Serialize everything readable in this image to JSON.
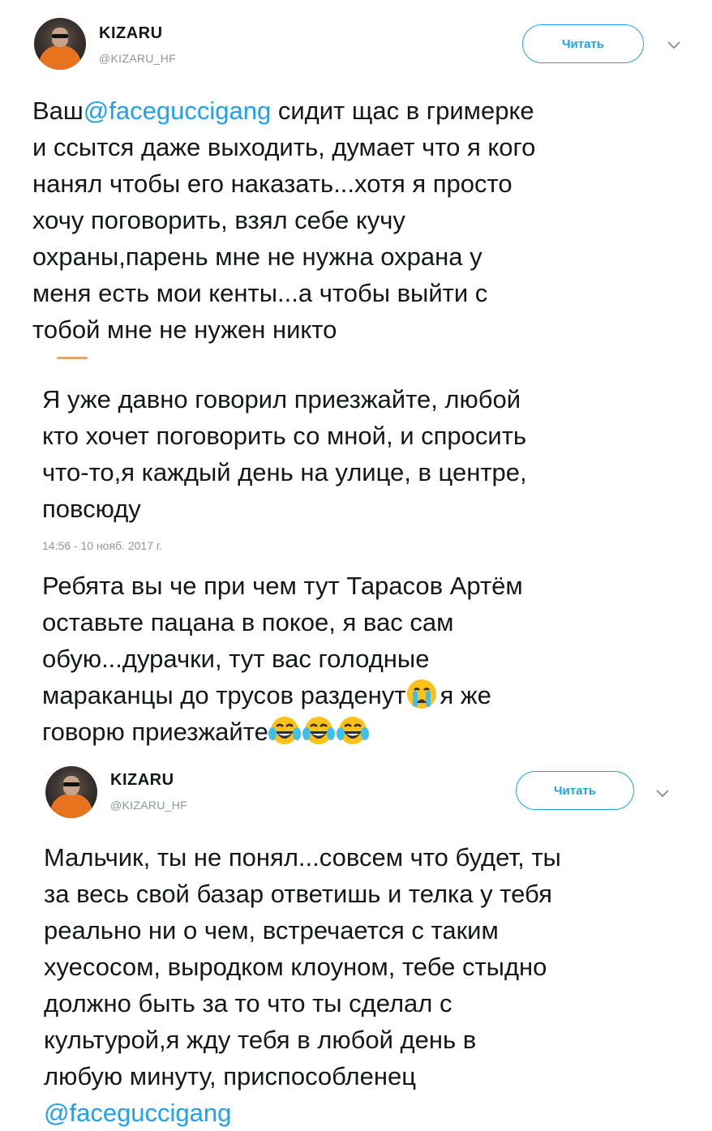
{
  "tweet1": {
    "name": "KIZARU",
    "handle": "@KIZARU_HF",
    "follow_label": "Читать",
    "text_start": "Ваш",
    "mention": "@faceguccigang",
    "text_rest": " сидит щас в гримерке\nи ссытся даже выходить, думает что я кого\nнанял чтобы его наказать...хотя я просто\nхочу поговорить, взял себе кучу\nохраны,парень мне не нужна охрана у\nменя есть мои кенты...а чтобы выйти с\nтобой мне не нужен никто"
  },
  "tweet2": {
    "text": "Я уже давно говорил приезжайте, любой\nкто хочет поговорить со мной, и спросить\nчто-то,я каждый день на улице, в центре,\nповсюду",
    "timestamp": "14:56 - 10 нояб. 2017 г."
  },
  "tweet3": {
    "text_part1": "Ребята вы че при чем тут Тарасов Артём\nоставьте пацана в покое, я вас сам\nобую...дурачки, тут вас голодные\nмараканцы до трусов разденут",
    "text_part2": "я же\nговорю приезжайте",
    "emojis": [
      "crying-face",
      "tears-of-joy",
      "tears-of-joy",
      "tears-of-joy"
    ]
  },
  "tweet4": {
    "name": "KIZARU",
    "handle": "@KIZARU_HF",
    "follow_label": "Читать",
    "text": "Мальчик, ты не понял...совсем что будет, ты\nза весь свой базар ответишь и телка у тебя\nреально ни о чем, встречается с таким\nхуесосом, выродком клоуном, тебе стыдно\nдолжно быть за то что ты сделал с\nкультурой,я жду тебя в любой день в\nлюбую минуту, приспособленец",
    "mention": "@faceguccigang"
  },
  "colors": {
    "link": "#1da1f2",
    "text": "#14171a",
    "muted": "#8a959e"
  }
}
